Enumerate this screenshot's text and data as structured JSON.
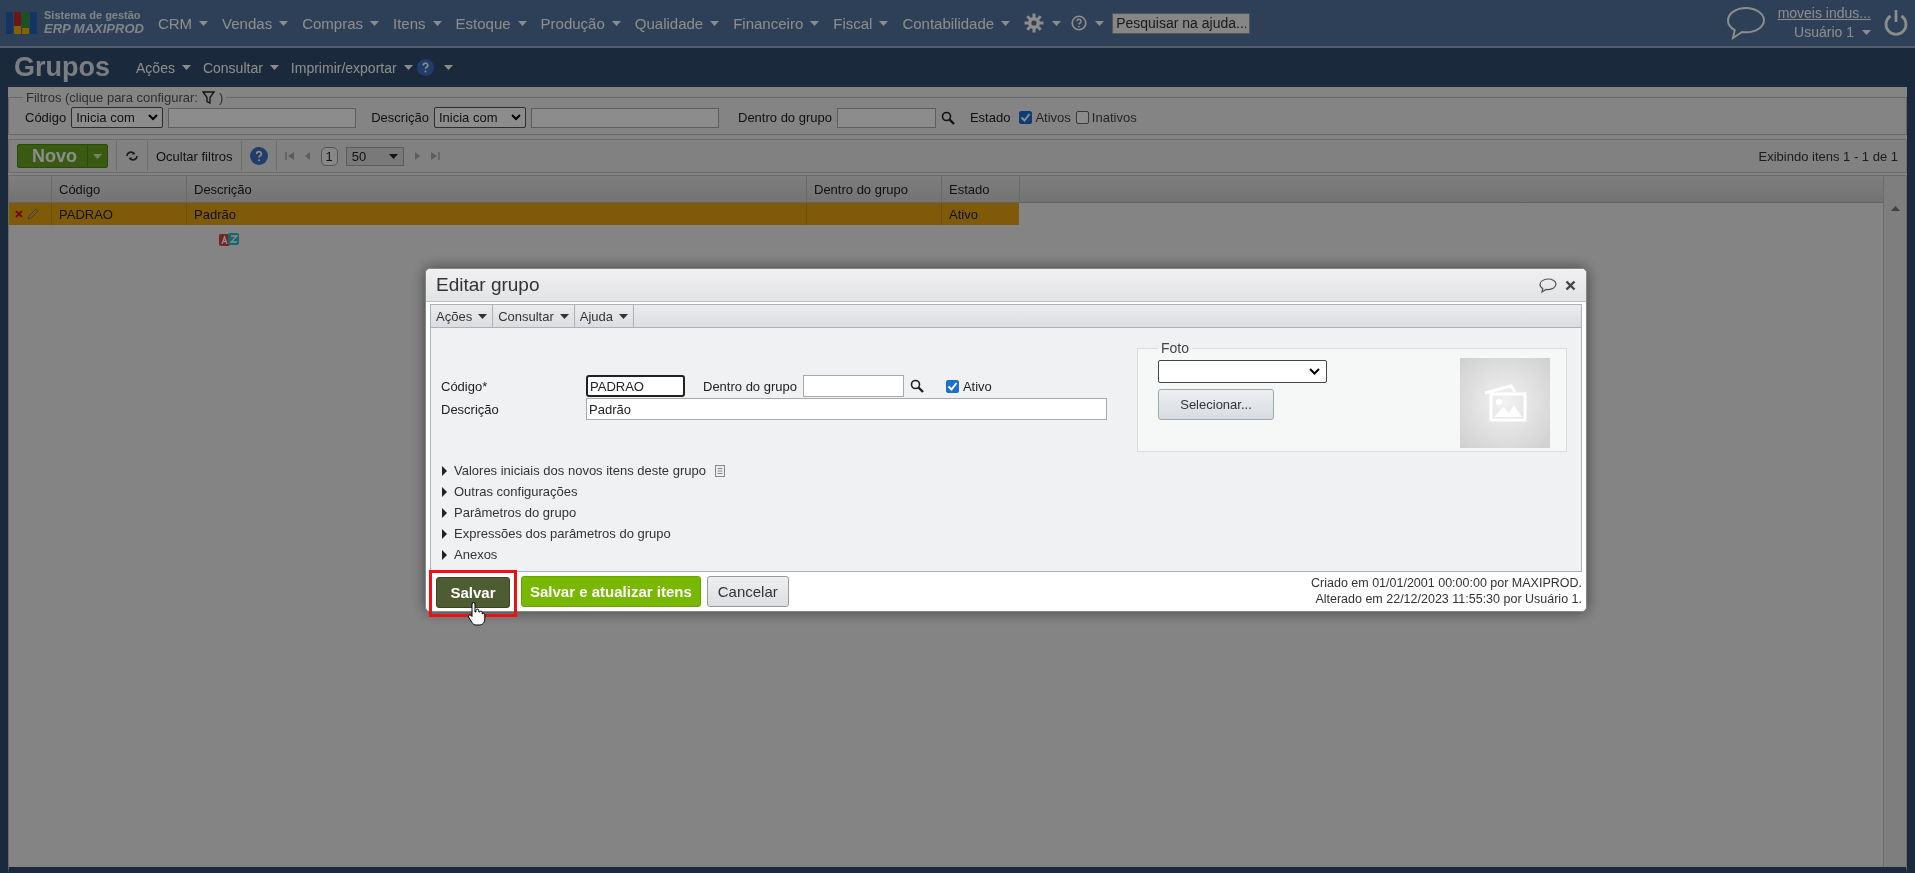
{
  "nav": {
    "logo_line1": "Sistema de gestão",
    "logo_line2": "ERP MAXIPROD",
    "menus": [
      "CRM",
      "Vendas",
      "Compras",
      "Itens",
      "Estoque",
      "Produção",
      "Qualidade",
      "Financeiro",
      "Fiscal",
      "Contabilidade"
    ],
    "search_placeholder": "Pesquisar na ajuda...",
    "company": "moveis indus...",
    "user": "Usuário 1"
  },
  "page": {
    "title": "Grupos",
    "menus": [
      "Ações",
      "Consultar",
      "Imprimir/exportar"
    ]
  },
  "filters": {
    "legend": "Filtros (clique para configurar:",
    "legend_end": ")",
    "codigo": {
      "label": "Código",
      "operator": "Inicia com"
    },
    "descricao": {
      "label": "Descrição",
      "operator": "Inicia com"
    },
    "grupo_label": "Dentro do grupo",
    "estado_label": "Estado",
    "options": [
      {
        "label": "Ativos",
        "checked": true
      },
      {
        "label": "Inativos",
        "checked": false
      }
    ]
  },
  "toolbar": {
    "new": "Novo",
    "hide_filters": "Ocultar filtros",
    "page": "1",
    "page_size": "50",
    "summary": "Exibindo itens 1 - 1 de 1"
  },
  "table": {
    "columns": [
      "Código",
      "Descrição",
      "Dentro do grupo",
      "Estado"
    ],
    "rows": [
      {
        "codigo": "PADRAO",
        "descricao": "Padrão",
        "estado": "Ativo",
        "selected": true
      }
    ]
  },
  "dialog": {
    "title": "Editar grupo",
    "menus": [
      "Ações",
      "Consultar",
      "Ajuda"
    ],
    "codigo_label": "Código*",
    "codigo_value": "PADRAO",
    "grupo_label": "Dentro do grupo",
    "ativo": {
      "label": "Ativo",
      "checked": true
    },
    "descricao_label": "Descrição",
    "descricao_value": "Padrão",
    "photo": {
      "legend": "Foto",
      "button": "Selecionar..."
    },
    "sections": [
      {
        "label": "Valores iniciais dos novos itens deste grupo",
        "kind": "note",
        "expanded": false
      },
      {
        "label": "Outras configurações",
        "kind": "plain",
        "expanded": false
      },
      {
        "label": "Parâmetros do grupo",
        "kind": "plain",
        "expanded": false
      },
      {
        "label": "Expressões dos parâmetros do grupo",
        "kind": "plain",
        "expanded": false
      },
      {
        "label": "Anexos",
        "kind": "plain",
        "expanded": false
      }
    ],
    "buttons": [
      {
        "label": "Salvar",
        "kind": "primary",
        "highlighted": true
      },
      {
        "label": "Salvar e atualizar itens",
        "kind": "success",
        "highlighted": false
      },
      {
        "label": "Cancelar",
        "kind": "default",
        "highlighted": false
      }
    ],
    "created": "Criado em 01/01/2001 00:00:00 por MAXIPROD.",
    "modified": "Alterado em 22/12/2023 11:55:30 por Usuário 1."
  }
}
